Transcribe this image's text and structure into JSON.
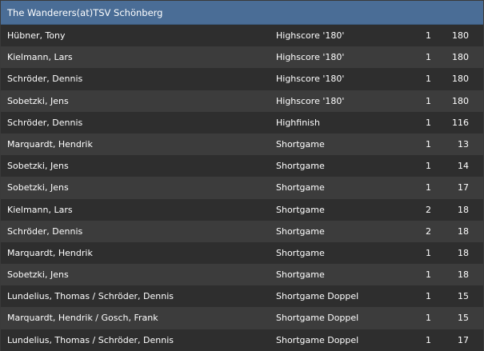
{
  "table": {
    "title": "The Wanderers(at)TSV Schönberg",
    "rows": [
      {
        "name": "Hübner, Tony",
        "category": "Highscore '180'",
        "count": "1",
        "score": "180"
      },
      {
        "name": "Kielmann, Lars",
        "category": "Highscore '180'",
        "count": "1",
        "score": "180"
      },
      {
        "name": "Schröder, Dennis",
        "category": "Highscore '180'",
        "count": "1",
        "score": "180"
      },
      {
        "name": "Sobetzki, Jens",
        "category": "Highscore '180'",
        "count": "1",
        "score": "180"
      },
      {
        "name": "Schröder, Dennis",
        "category": "Highfinish",
        "count": "1",
        "score": "116"
      },
      {
        "name": "Marquardt, Hendrik",
        "category": "Shortgame",
        "count": "1",
        "score": "13"
      },
      {
        "name": "Sobetzki, Jens",
        "category": "Shortgame",
        "count": "1",
        "score": "14"
      },
      {
        "name": "Sobetzki, Jens",
        "category": "Shortgame",
        "count": "1",
        "score": "17"
      },
      {
        "name": "Kielmann, Lars",
        "category": "Shortgame",
        "count": "2",
        "score": "18"
      },
      {
        "name": "Schröder, Dennis",
        "category": "Shortgame",
        "count": "2",
        "score": "18"
      },
      {
        "name": "Marquardt, Hendrik",
        "category": "Shortgame",
        "count": "1",
        "score": "18"
      },
      {
        "name": "Sobetzki, Jens",
        "category": "Shortgame",
        "count": "1",
        "score": "18"
      },
      {
        "name": "Lundelius, Thomas / Schröder, Dennis",
        "category": "Shortgame Doppel",
        "count": "1",
        "score": "15"
      },
      {
        "name": "Marquardt, Hendrik / Gosch, Frank",
        "category": "Shortgame Doppel",
        "count": "1",
        "score": "15"
      },
      {
        "name": "Lundelius, Thomas / Schröder, Dennis",
        "category": "Shortgame Doppel",
        "count": "1",
        "score": "17"
      }
    ]
  },
  "colors": {
    "header_bg": "#4a6d96",
    "row_odd": "#2e2e2e",
    "row_even": "#3c3c3c",
    "text": "#ffffff"
  }
}
